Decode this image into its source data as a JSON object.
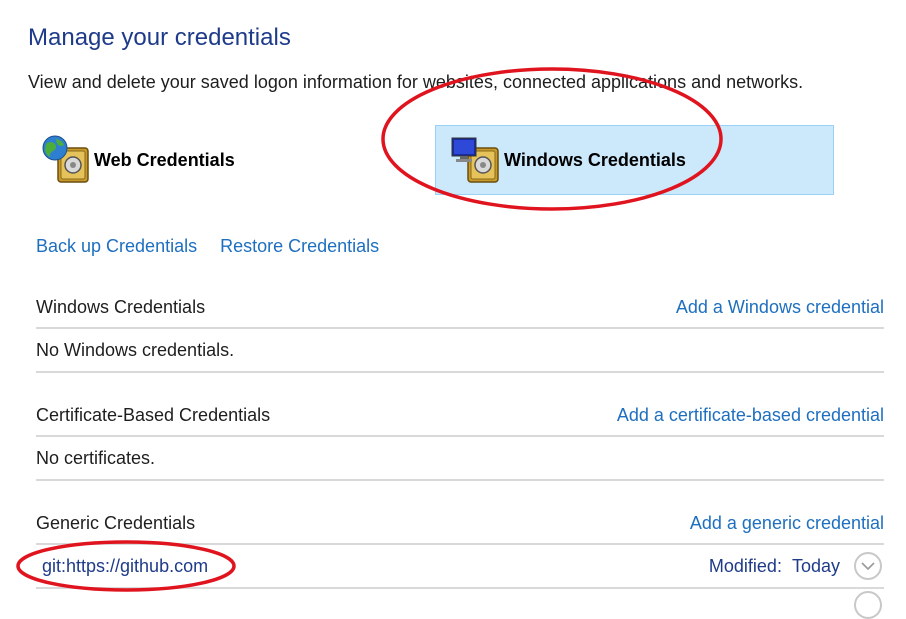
{
  "page": {
    "title": "Manage your credentials",
    "subtitle": "View and delete your saved logon information for websites, connected applications and networks."
  },
  "tabs": {
    "web": {
      "label": "Web Credentials",
      "icon": "globe-vault-icon"
    },
    "windows": {
      "label": "Windows Credentials",
      "icon": "monitor-vault-icon",
      "selected": true
    }
  },
  "actions": {
    "backup": "Back up Credentials",
    "restore": "Restore Credentials"
  },
  "sections": {
    "windows": {
      "title": "Windows Credentials",
      "add_label": "Add a Windows credential",
      "empty": "No Windows credentials."
    },
    "certificate": {
      "title": "Certificate-Based Credentials",
      "add_label": "Add a certificate-based credential",
      "empty": "No certificates."
    },
    "generic": {
      "title": "Generic Credentials",
      "add_label": "Add a generic credential",
      "items": [
        {
          "name": "git:https://github.com",
          "modified_label": "Modified:",
          "modified_value": "Today"
        }
      ]
    }
  },
  "colors": {
    "title": "#1e3b8a",
    "link": "#1e6fbf",
    "selected_tab_bg": "#cce8fb",
    "annotation": "#e0141e"
  }
}
